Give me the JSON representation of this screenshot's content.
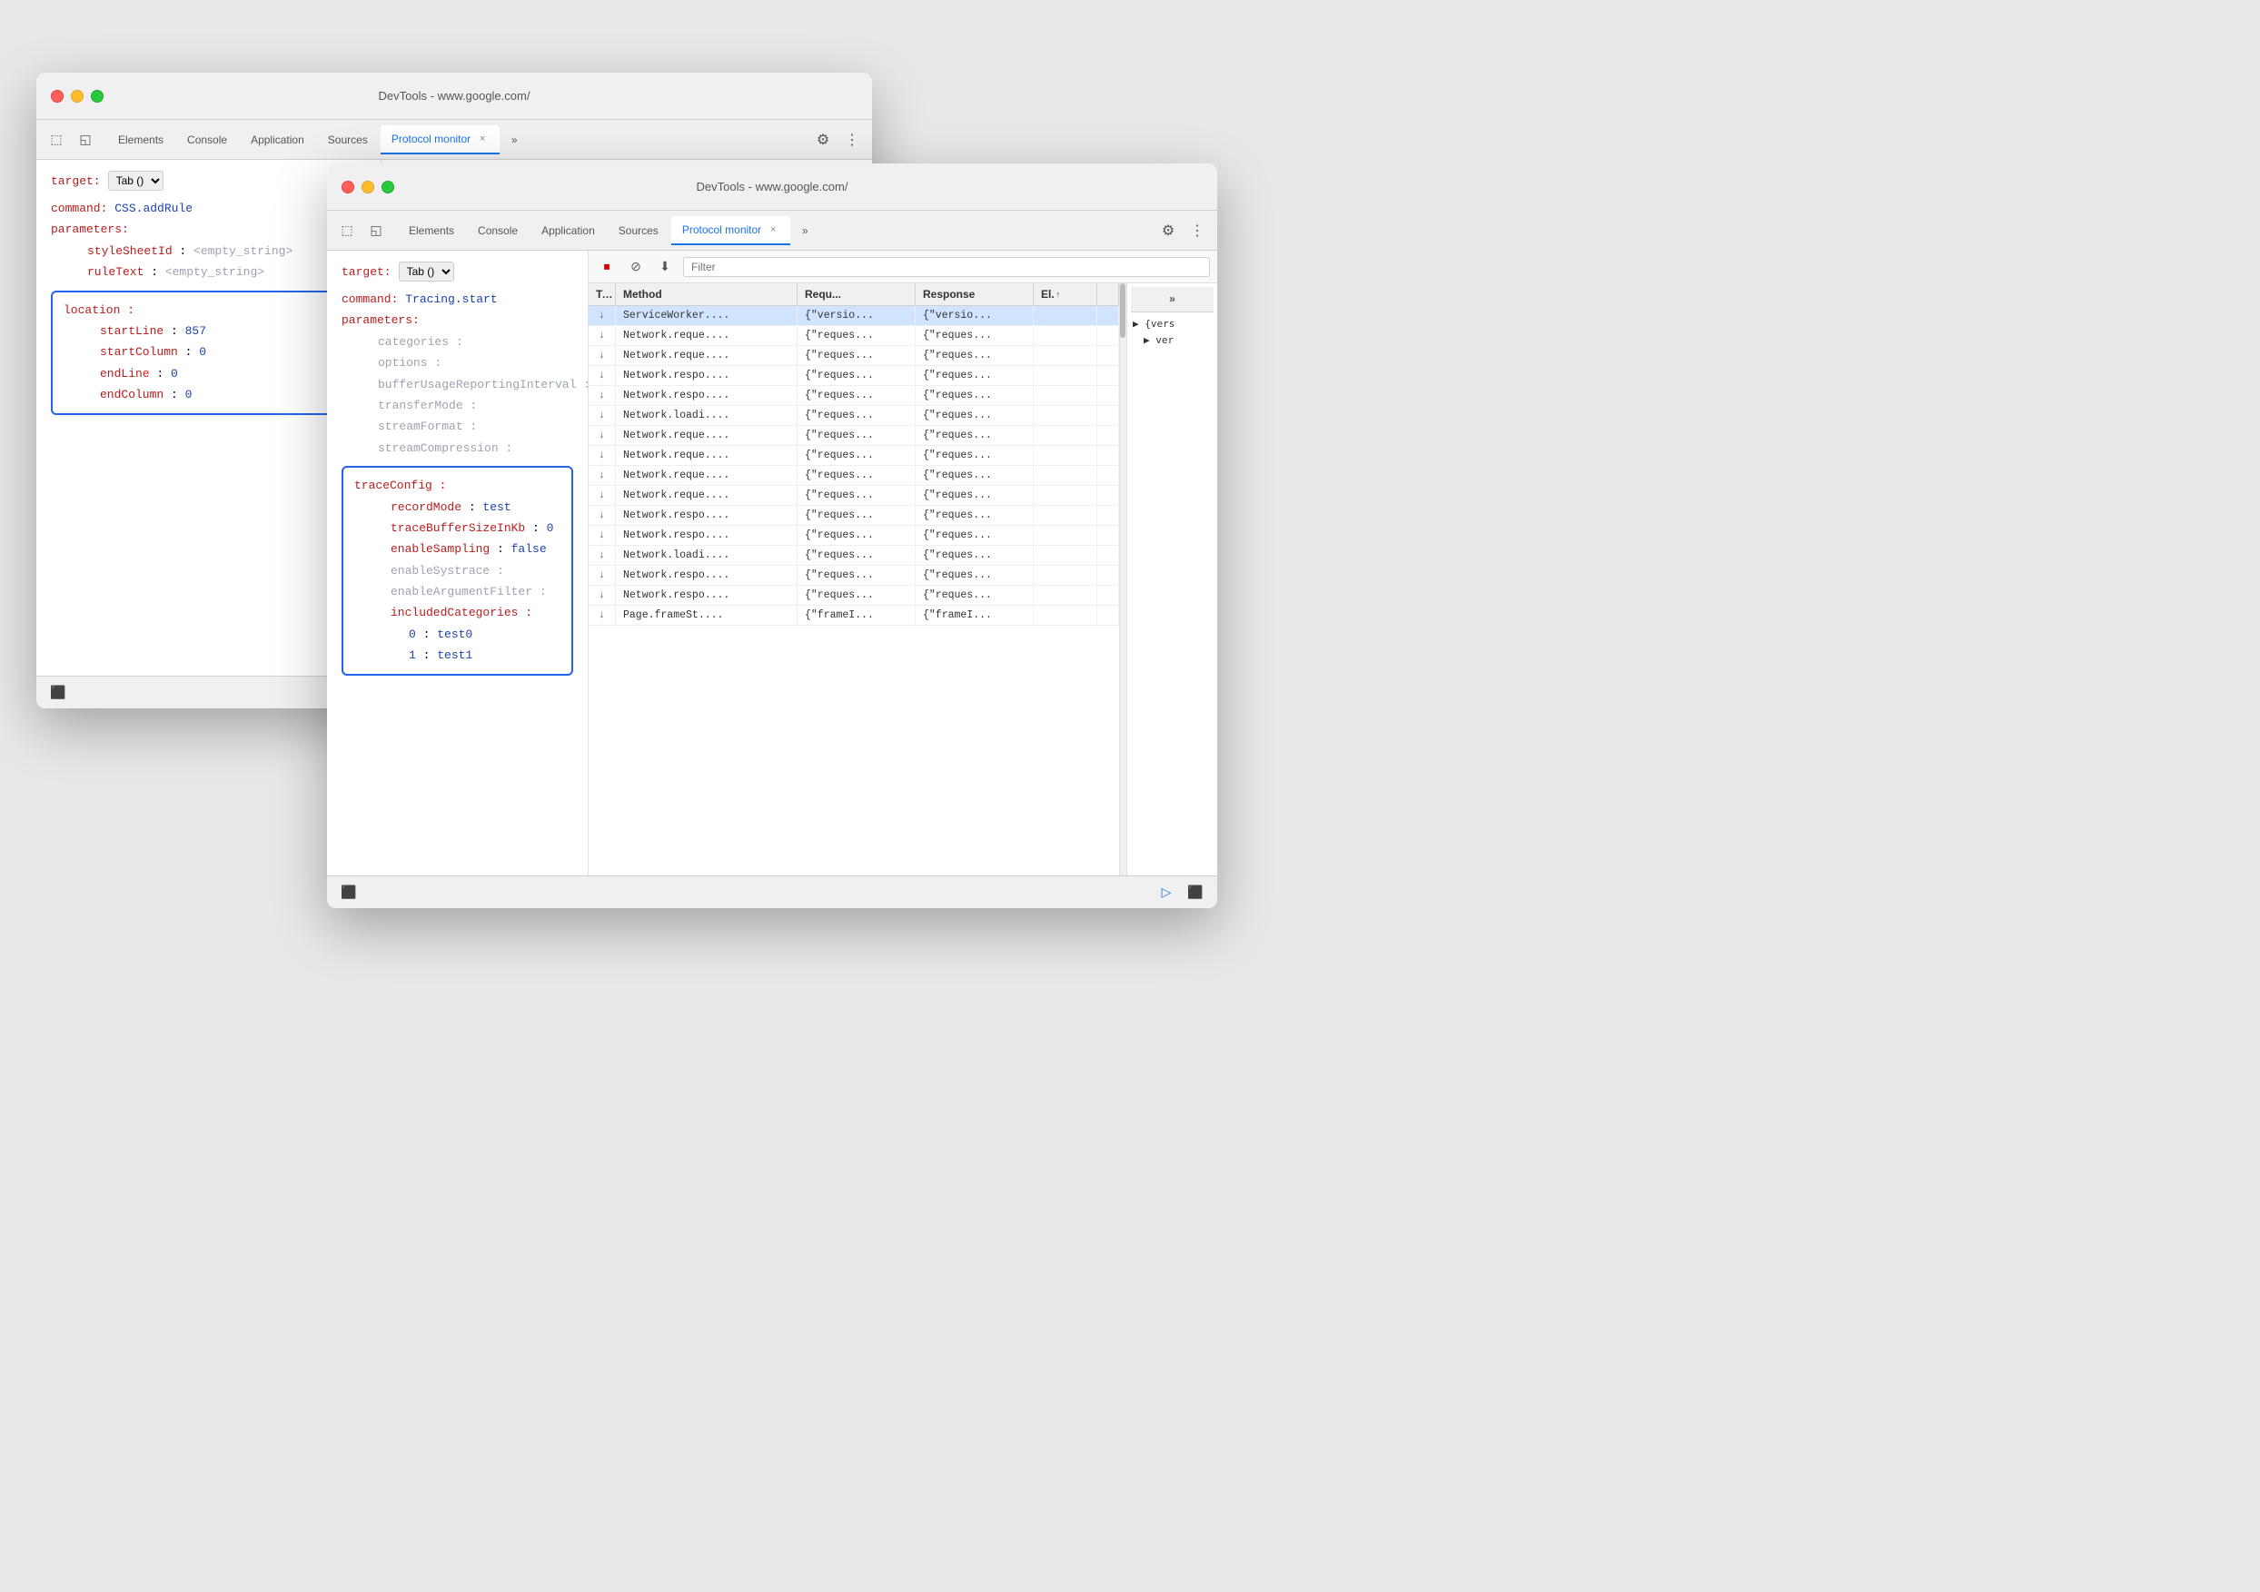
{
  "window1": {
    "title": "DevTools - www.google.com/",
    "tabs": [
      {
        "label": "Elements",
        "active": false
      },
      {
        "label": "Console",
        "active": false
      },
      {
        "label": "Application",
        "active": false
      },
      {
        "label": "Sources",
        "active": false
      },
      {
        "label": "Protocol monitor",
        "active": true
      }
    ],
    "target_label": "target:",
    "target_value": "Tab ()",
    "command_label": "command:",
    "command_value": "CSS.addRule",
    "parameters_label": "parameters:",
    "params": [
      {
        "key": "styleSheetId",
        "value": "<empty_string>",
        "indent": 2
      },
      {
        "key": "ruleText",
        "value": "<empty_string>",
        "indent": 2
      }
    ],
    "location_label": "location",
    "location_params": [
      {
        "key": "startLine",
        "value": "857"
      },
      {
        "key": "startColumn",
        "value": "0"
      },
      {
        "key": "endLine",
        "value": "0"
      },
      {
        "key": "endColumn",
        "value": "0"
      }
    ]
  },
  "window2": {
    "title": "DevTools - www.google.com/",
    "tabs": [
      {
        "label": "Elements",
        "active": false
      },
      {
        "label": "Console",
        "active": false
      },
      {
        "label": "Application",
        "active": false
      },
      {
        "label": "Sources",
        "active": false
      },
      {
        "label": "Protocol monitor",
        "active": true
      }
    ],
    "target_label": "target:",
    "target_value": "Tab ()",
    "command_label": "command:",
    "command_value": "Tracing.start",
    "parameters_label": "parameters:",
    "params": [
      {
        "key": "categories",
        "indent": 2
      },
      {
        "key": "options",
        "indent": 2
      },
      {
        "key": "bufferUsageReportingInterval",
        "indent": 2
      },
      {
        "key": "transferMode",
        "indent": 2
      },
      {
        "key": "streamFormat",
        "indent": 2
      },
      {
        "key": "streamCompression",
        "indent": 2
      }
    ],
    "trace_config_label": "traceConfig",
    "trace_config_params": [
      {
        "key": "recordMode",
        "value": "test"
      },
      {
        "key": "traceBufferSizeInKb",
        "value": "0"
      },
      {
        "key": "enableSampling",
        "value": "false"
      },
      {
        "key": "enableSystrace"
      },
      {
        "key": "enableArgumentFilter"
      },
      {
        "key": "includedCategories"
      }
    ],
    "included_categories": [
      {
        "index": "0",
        "value": "test0"
      },
      {
        "index": "1",
        "value": "test1"
      }
    ],
    "filter_placeholder": "Filter",
    "network_headers": [
      "Type",
      "Method",
      "Requ...",
      "Response",
      "El.↑",
      ""
    ],
    "network_rows": [
      {
        "arrow": "↓",
        "method": "ServiceWorker....",
        "request": "{\"versio...",
        "response": "{\"versio...",
        "el": "",
        "selected": true
      },
      {
        "arrow": "↓",
        "method": "Network.reque....",
        "request": "{\"reques...",
        "response": "{\"reques...",
        "el": ""
      },
      {
        "arrow": "↓",
        "method": "Network.reque....",
        "request": "{\"reques...",
        "response": "{\"reques...",
        "el": ""
      },
      {
        "arrow": "↓",
        "method": "Network.respo....",
        "request": "{\"reques...",
        "response": "{\"reques...",
        "el": ""
      },
      {
        "arrow": "↓",
        "method": "Network.respo....",
        "request": "{\"reques...",
        "response": "{\"reques...",
        "el": ""
      },
      {
        "arrow": "↓",
        "method": "Network.loadi....",
        "request": "{\"reques...",
        "response": "{\"reques...",
        "el": ""
      },
      {
        "arrow": "↓",
        "method": "Network.reque....",
        "request": "{\"reques...",
        "response": "{\"reques...",
        "el": ""
      },
      {
        "arrow": "↓",
        "method": "Network.reque....",
        "request": "{\"reques...",
        "response": "{\"reques...",
        "el": ""
      },
      {
        "arrow": "↓",
        "method": "Network.reque....",
        "request": "{\"reques...",
        "response": "{\"reques...",
        "el": ""
      },
      {
        "arrow": "↓",
        "method": "Network.reque....",
        "request": "{\"reques...",
        "response": "{\"reques...",
        "el": ""
      },
      {
        "arrow": "↓",
        "method": "Network.respo....",
        "request": "{\"reques...",
        "response": "{\"reques...",
        "el": ""
      },
      {
        "arrow": "↓",
        "method": "Network.respo....",
        "request": "{\"reques...",
        "response": "{\"reques...",
        "el": ""
      },
      {
        "arrow": "↓",
        "method": "Network.loadi....",
        "request": "{\"reques...",
        "response": "{\"reques...",
        "el": ""
      },
      {
        "arrow": "↓",
        "method": "Network.respo....",
        "request": "{\"reques...",
        "response": "{\"reques...",
        "el": ""
      },
      {
        "arrow": "↓",
        "method": "Network.respo....",
        "request": "{\"reques...",
        "response": "{\"reques...",
        "el": ""
      },
      {
        "arrow": "↓",
        "method": "Page.frameSt....",
        "request": "{\"frameI...",
        "response": "{\"frameI...",
        "el": ""
      }
    ],
    "sidebar_content": "▶ {vers\n  ▶ ver"
  },
  "icons": {
    "close": "×",
    "gear": "⚙",
    "more_vert": "⋮",
    "more_horiz": "»",
    "inspector": "⬚",
    "device": "◱",
    "record_stop": "⏹",
    "clear": "⊘",
    "download": "⬇",
    "send": "▷",
    "dock": "⬛"
  }
}
